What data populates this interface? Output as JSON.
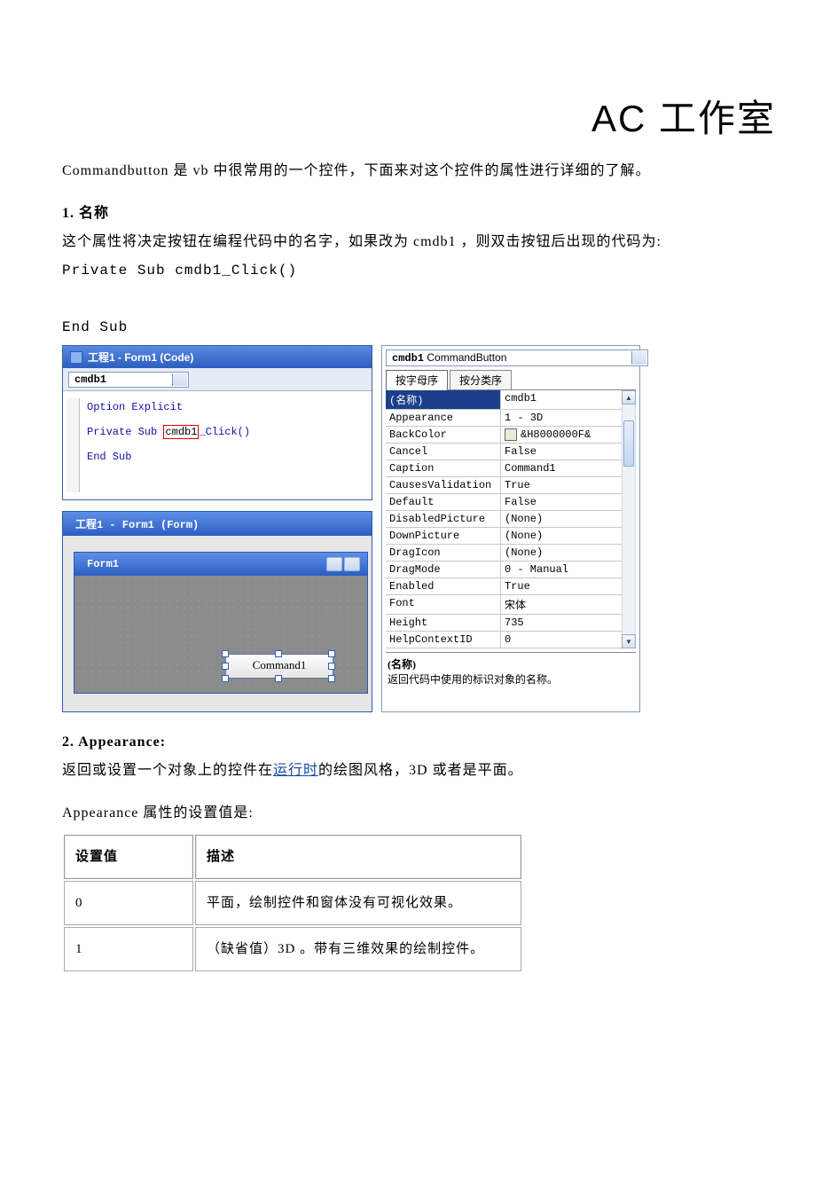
{
  "title_right": "AC 工作室",
  "intro": "Commandbutton 是 vb 中很常用的一个控件，下面来对这个控件的属性进行详细的了解。",
  "section1": {
    "heading": "1.  名称",
    "line1": "这个属性将决定按钮在编程代码中的名字，如果改为 cmdb1 ，则双击按钮后出现的代码为:",
    "code1": "Private Sub cmdb1_Click()",
    "code2": "End Sub"
  },
  "code_window": {
    "title": "工程1 - Form1 (Code)",
    "combo": "cmdb1",
    "lines": {
      "l1": "Option Explicit",
      "l2a": "Private Sub ",
      "l2b": "cmdb1",
      "l2c": "_Click()",
      "l3": "End Sub"
    }
  },
  "form_window": {
    "outer_title": "工程1 - Form1 (Form)",
    "inner_title": "Form1",
    "button_caption": "Command1"
  },
  "props": {
    "object": "cmdb1",
    "object_type": "CommandButton",
    "tab1": "按字母序",
    "tab2": "按分类序",
    "rows": [
      {
        "name": "(名称)",
        "value": "cmdb1",
        "selected": true
      },
      {
        "name": "Appearance",
        "value": "1 - 3D"
      },
      {
        "name": "BackColor",
        "value": "&H8000000F&",
        "color": true
      },
      {
        "name": "Cancel",
        "value": "False"
      },
      {
        "name": "Caption",
        "value": "Command1"
      },
      {
        "name": "CausesValidation",
        "value": "True"
      },
      {
        "name": "Default",
        "value": "False"
      },
      {
        "name": "DisabledPicture",
        "value": "(None)"
      },
      {
        "name": "DownPicture",
        "value": "(None)"
      },
      {
        "name": "DragIcon",
        "value": "(None)"
      },
      {
        "name": "DragMode",
        "value": "0 - Manual"
      },
      {
        "name": "Enabled",
        "value": "True"
      },
      {
        "name": "Font",
        "value": "宋体"
      },
      {
        "name": "Height",
        "value": "735"
      },
      {
        "name": "HelpContextID",
        "value": "0"
      }
    ],
    "desc_title": "(名称)",
    "desc_text": "返回代码中使用的标识对象的名称。"
  },
  "section2": {
    "heading": "2. Appearance:",
    "line_before_link": "返回或设置一个对象上的控件在",
    "link_text": "运行时",
    "line_after_link": "的绘图风格，3D 或者是平面。",
    "sub": "Appearance  属性的设置值是:"
  },
  "appearance_table": {
    "headers": {
      "c1": "设置值",
      "c2": "描述"
    },
    "rows": [
      {
        "v": "0",
        "d": "平面，绘制控件和窗体没有可视化效果。"
      },
      {
        "v": "1",
        "d": "（缺省值）3D 。带有三维效果的绘制控件。"
      }
    ]
  }
}
